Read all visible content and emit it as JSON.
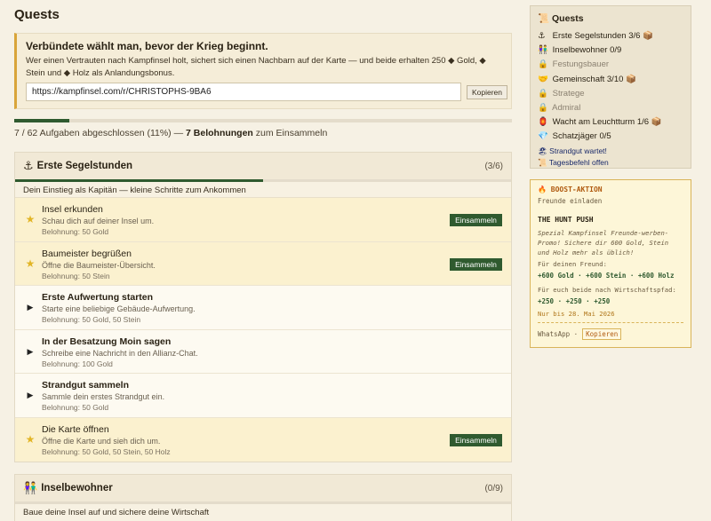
{
  "page": {
    "title": "Quests"
  },
  "invite": {
    "heading": "Verbündete wählt man, bevor der Krieg beginnt.",
    "text": "Wer einen Vertrauten nach Kampfinsel holt, sichert sich einen Nachbarn auf der Karte — und beide erhalten 250 ◆ Gold, ◆ Stein und ◆ Holz als Anlandungsbonus.",
    "link": "https://kampfinsel.com/r/CHRISTOPHS-9BA6",
    "copy_label": "Kopieren"
  },
  "progress": {
    "fraction": 0.11,
    "text_pre": "7 / 62 Aufgaben abgeschlossen (11%) — ",
    "rewards": "7 Belohnungen",
    "text_post": " zum Einsammeln"
  },
  "sections": [
    {
      "icon": "⚓",
      "title": "Erste Segelstunden",
      "count": "(3/6)",
      "fraction": 0.5,
      "subtitle": "Dein Einstieg als Kapitän — kleine Schritte zum Ankommen",
      "quests": [
        {
          "state": "done",
          "title": "Insel erkunden",
          "desc": "Schau dich auf deiner Insel um.",
          "reward": "Belohnung: 50 Gold",
          "button": "Einsammeln"
        },
        {
          "state": "done",
          "title": "Baumeister begrüßen",
          "desc": "Öffne die Baumeister-Übersicht.",
          "reward": "Belohnung: 50 Stein",
          "button": "Einsammeln"
        },
        {
          "state": "open",
          "title": "Erste Aufwertung starten",
          "desc": "Starte eine beliebige Gebäude-Aufwertung.",
          "reward": "Belohnung: 50 Gold, 50 Stein",
          "button": ""
        },
        {
          "state": "open",
          "title": "In der Besatzung Moin sagen",
          "desc": "Schreibe eine Nachricht in den Allianz-Chat.",
          "reward": "Belohnung: 100 Gold",
          "button": ""
        },
        {
          "state": "open",
          "title": "Strandgut sammeln",
          "desc": "Sammle dein erstes Strandgut ein.",
          "reward": "Belohnung: 50 Gold",
          "button": ""
        },
        {
          "state": "done",
          "title": "Die Karte öffnen",
          "desc": "Öffne die Karte und sieh dich um.",
          "reward": "Belohnung: 50 Gold, 50 Stein, 50 Holz",
          "button": "Einsammeln"
        }
      ]
    },
    {
      "icon": "👫",
      "title": "Inselbewohner",
      "count": "(0/9)",
      "subtitle": "Baue deine Insel auf und sichere deine Wirtschaft"
    }
  ],
  "sidebar": {
    "title": "Quests",
    "items": [
      {
        "icon": "⚓",
        "label": "Erste Segelstunden 3/6",
        "badge": "📦",
        "locked": false
      },
      {
        "icon": "👫",
        "label": "Inselbewohner 0/9",
        "badge": "",
        "locked": false
      },
      {
        "icon": "🔒",
        "label": "Festungsbauer",
        "badge": "",
        "locked": true
      },
      {
        "icon": "🤝",
        "label": "Gemeinschaft 3/10",
        "badge": "📦",
        "locked": false
      },
      {
        "icon": "🔒",
        "label": "Stratege",
        "badge": "",
        "locked": true
      },
      {
        "icon": "🔒",
        "label": "Admiral",
        "badge": "",
        "locked": true
      },
      {
        "icon": "🏮",
        "label": "Wacht am Leuchtturm 1/6",
        "badge": "📦",
        "locked": false
      },
      {
        "icon": "💎",
        "label": "Schatzjäger 0/5",
        "badge": "",
        "locked": false
      }
    ],
    "notes": [
      {
        "icon": "🏖",
        "label": "Strandgut wartet!"
      },
      {
        "icon": "📜",
        "label": "Tagesbefehl offen"
      }
    ]
  },
  "boost": {
    "heading": "BOOST-AKTION",
    "sub": "Freunde einladen",
    "title": "THE HUNT PUSH",
    "desc": "Spezial Kampfinsel Freunde-werben-Promo! Sichere dir 600 Gold, Stein und Holz mehr als üblich!",
    "friend_label": "Für deinen Freund:",
    "friend_values": "+600 Gold · +600 Stein · +600 Holz",
    "both_label": "Für euch beide nach Wirtschaftspfad:",
    "both_values": "+250 · +250 · +250",
    "date": "Nur bis 28. Mai 2026",
    "share": "WhatsApp ·",
    "copy_label": "Kopieren"
  }
}
